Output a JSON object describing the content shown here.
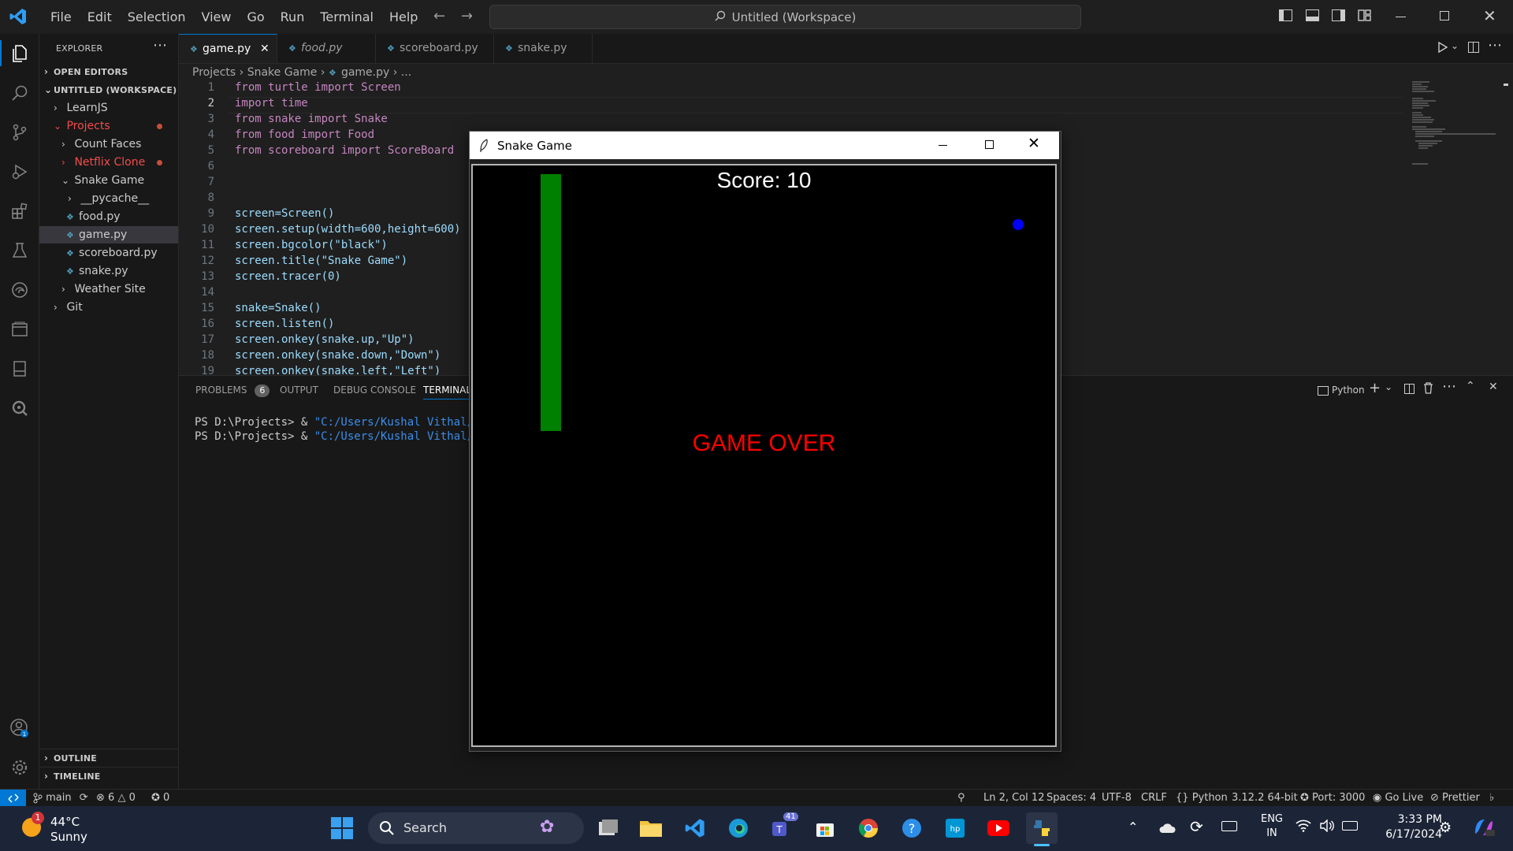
{
  "window": {
    "menus": [
      "File",
      "Edit",
      "Selection",
      "View",
      "Go",
      "Run",
      "Terminal",
      "Help"
    ],
    "command_center": "Untitled (Workspace)"
  },
  "sidebar": {
    "title": "EXPLORER",
    "open_editors": "OPEN EDITORS",
    "workspace": "UNTITLED (WORKSPACE)",
    "tree": [
      {
        "label": "LearnJS"
      },
      {
        "label": "Projects"
      },
      {
        "label": "Count Faces"
      },
      {
        "label": "Netflix Clone"
      },
      {
        "label": "Snake Game"
      },
      {
        "label": "__pycache__"
      },
      {
        "label": "food.py"
      },
      {
        "label": "game.py"
      },
      {
        "label": "scoreboard.py"
      },
      {
        "label": "snake.py"
      },
      {
        "label": "Weather Site"
      },
      {
        "label": "Git"
      }
    ],
    "outline": "OUTLINE",
    "timeline": "TIMELINE"
  },
  "tabs": [
    {
      "label": "game.py",
      "active": true
    },
    {
      "label": "food.py"
    },
    {
      "label": "scoreboard.py"
    },
    {
      "label": "snake.py"
    }
  ],
  "breadcrumb": {
    "p1": "Projects",
    "p2": "Snake Game",
    "p3": "game.py",
    "p4": "..."
  },
  "code": {
    "l1": "from turtle import Screen",
    "l2": "import time",
    "l3": "from snake import Snake",
    "l4": "from food import Food",
    "l5": "from scoreboard import ScoreBoard",
    "l9": "screen=Screen()",
    "l10": "screen.setup(width=600,height=600)",
    "l11": "screen.bgcolor(\"black\")",
    "l12": "screen.title(\"Snake Game\")",
    "l13": "screen.tracer(0)",
    "l15": "snake=Snake()",
    "l16": "screen.listen()",
    "l17": "screen.onkey(snake.up,\"Up\")",
    "l18": "screen.onkey(snake.down,\"Down\")",
    "l19": "screen.onkey(snake.left,\"Left\")"
  },
  "panel": {
    "problems": "PROBLEMS",
    "problems_count": "6",
    "output": "OUTPUT",
    "debug_console": "DEBUG CONSOLE",
    "terminal": "TERMINAL",
    "shell": "Python",
    "term_line1_prompt": "PS D:\\Projects> & ",
    "term_line1_path": "\"C:/Users/Kushal Vithal/Ap",
    "term_line2_prompt": "PS D:\\Projects> & ",
    "term_line2_path": "\"C:/Users/Kushal Vithal/Ap"
  },
  "game": {
    "window_title": "Snake Game",
    "score_text": "Score: 10",
    "game_over_text": "GAME OVER"
  },
  "status": {
    "branch": "main",
    "errors": "6",
    "warnings": "0",
    "ports": "0",
    "position": "Ln 2, Col 12",
    "spaces": "Spaces: 4",
    "encoding": "UTF-8",
    "eol": "CRLF",
    "language": "Python",
    "interpreter": "3.12.2 64-bit",
    "port": "Port: 3000",
    "go_live": "Go Live",
    "prettier": "Prettier"
  },
  "taskbar": {
    "temp": "44°C",
    "weather": "Sunny",
    "search": "Search",
    "lang1": "ENG",
    "lang2": "IN",
    "time": "3:33 PM",
    "date": "6/17/2024",
    "teams_badge": "41",
    "weather_badge": "1"
  },
  "colors": {
    "accent": "#0078d4",
    "snake": "#008000",
    "food": "#0000ff",
    "game_over": "#ff0000",
    "modified": "#f14c4c"
  }
}
